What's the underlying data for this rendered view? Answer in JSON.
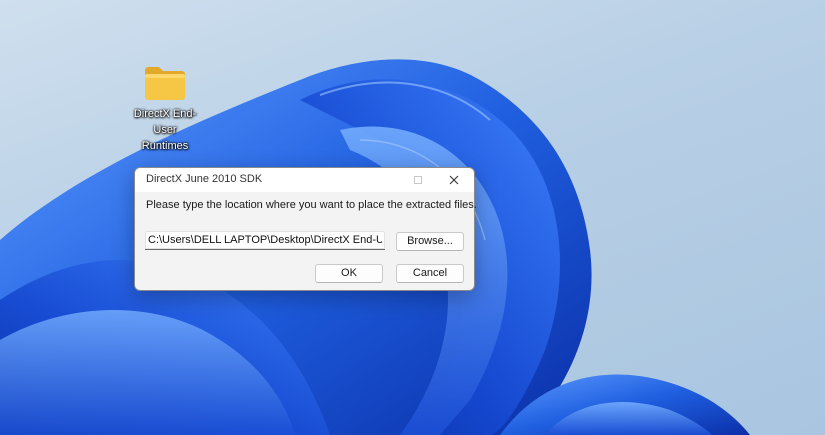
{
  "desktop": {
    "icon": {
      "name": "folder-icon",
      "label": "DirectX End-User Runtimes"
    }
  },
  "dialog": {
    "title": "DirectX June 2010 SDK",
    "prompt": "Please type the location where you want to place the extracted files.",
    "path_value": "C:\\Users\\DELL LAPTOP\\Desktop\\DirectX End-User Runtimes",
    "browse_label": "Browse...",
    "ok_label": "OK",
    "cancel_label": "Cancel",
    "close_icon": "close-icon",
    "maximize_icon": "maximize-icon"
  },
  "colors": {
    "folder": "#f6c744",
    "dialog_bg": "#f3f3f3",
    "wallpaper_blue": "#1f5fe0"
  }
}
